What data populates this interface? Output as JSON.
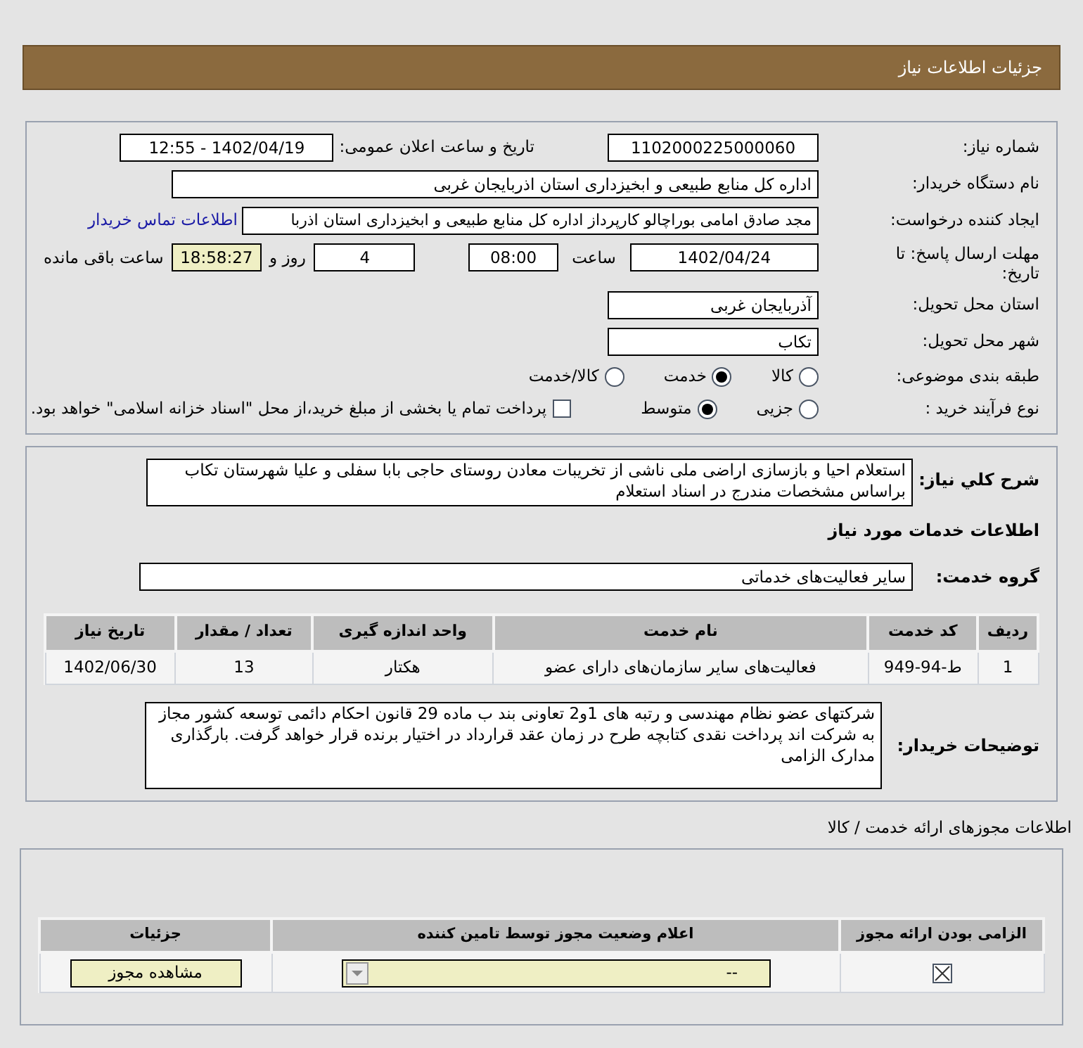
{
  "header": {
    "title": "جزئیات اطلاعات نیاز"
  },
  "need_number": {
    "label": "شماره نیاز:",
    "value": "1102000225000060"
  },
  "announce_date": {
    "label": "تاریخ و ساعت اعلان عمومی:",
    "value": "1402/04/19 - 12:55"
  },
  "buyer_org": {
    "label": "نام دستگاه خریدار:",
    "value": "اداره کل منابع طبیعی و ابخیزداری استان اذربایجان غربی"
  },
  "requester": {
    "label": "ایجاد کننده درخواست:",
    "value": "مجد صادق امامی بوراچالو کارپرداز اداره کل منابع طبیعی و ابخیزداری استان اذربا",
    "link": "اطلاعات تماس خریدار"
  },
  "deadline": {
    "label": "مهلت ارسال پاسخ: تا تاریخ:",
    "date": "1402/04/24",
    "time_label": "ساعت",
    "time": "08:00",
    "days": "4",
    "days_label": "روز و",
    "remaining": "18:58:27",
    "remaining_label": "ساعت باقی مانده"
  },
  "province": {
    "label": "استان محل تحویل:",
    "value": "آذربایجان غربی"
  },
  "city": {
    "label": "شهر محل تحویل:",
    "value": "تکاب"
  },
  "category": {
    "label": "طبقه بندی موضوعی:",
    "options": [
      {
        "label": "کالا",
        "selected": false
      },
      {
        "label": "خدمت",
        "selected": true
      },
      {
        "label": "کالا/خدمت",
        "selected": false
      }
    ]
  },
  "process": {
    "label": "نوع فرآیند خرید :",
    "options": [
      {
        "label": "جزیی",
        "selected": false
      },
      {
        "label": "متوسط",
        "selected": true
      }
    ],
    "payment": {
      "label": "پرداخت تمام یا بخشی از مبلغ خرید،از محل \"اسناد خزانه اسلامی\" خواهد بود.",
      "checked": false
    }
  },
  "description": {
    "label": "شرح کلي نياز:",
    "value": "استعلام احیا و بازسازی اراضی ملی ناشی از تخریبات معادن روستای حاجی بابا سفلی و علیا شهرستان تکاب براساس مشخصات مندرج در اسناد استعلام"
  },
  "services_title": "اطلاعات خدمات مورد نیاز",
  "service_group": {
    "label": "گروه خدمت:",
    "value": "سایر فعالیت‌های خدماتی"
  },
  "table": {
    "columns": [
      "ردیف",
      "کد خدمت",
      "نام خدمت",
      "واحد اندازه گیری",
      "تعداد / مقدار",
      "تاریخ نیاز"
    ],
    "rows": [
      [
        "1",
        "ط-94-949",
        "فعالیت‌های سایر سازمان‌های دارای عضو",
        "هکتار",
        "13",
        "1402/06/30"
      ]
    ]
  },
  "buyer_notes": {
    "label": "توضیحات خریدار:",
    "value": "شرکتهای عضو نظام مهندسی و رتبه های 1و2 تعاونی بند ب ماده 29 قانون احکام دائمی توسعه کشور مجاز به شرکت اند پرداخت نقدی کتابچه طرح در زمان عقد قرارداد در اختیار برنده قرار خواهد گرفت. بارگذاری مدارک الزامی"
  },
  "licenses": {
    "title": "اطلاعات مجوزهای ارائه خدمت / کالا",
    "columns": [
      "الزامی بودن ارائه مجوز",
      "اعلام وضعیت مجوز توسط تامین کننده",
      "جزئیات"
    ],
    "rows": [
      {
        "required": true,
        "status": "--",
        "button": "مشاهده مجوز"
      }
    ]
  }
}
